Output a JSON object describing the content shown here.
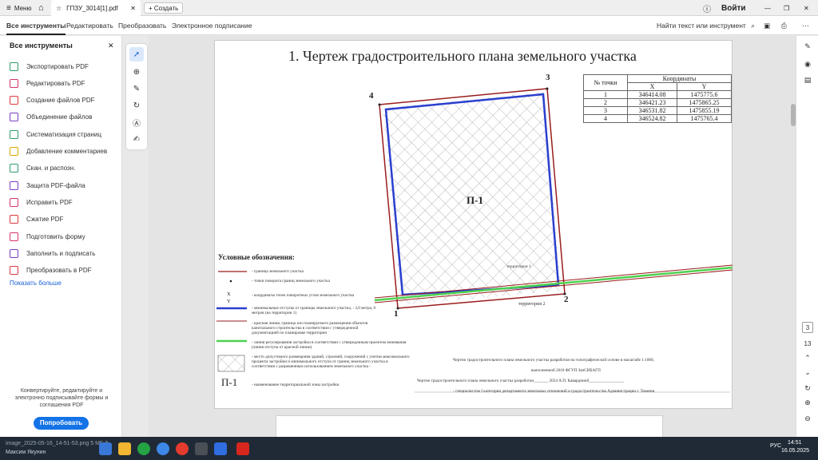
{
  "tabs": {
    "menu": "Меню",
    "doc_tab": "ГПЗУ_3014[1].pdf",
    "create": "+ Создать",
    "signin": "Войти"
  },
  "tools_bar": {
    "items": [
      "Все инструменты",
      "Редактировать",
      "Преобразовать",
      "Электронное подписание"
    ],
    "search": "Найти текст или инструмент"
  },
  "sidebar": {
    "title": "Все инструменты",
    "items": [
      {
        "label": "Экспортировать PDF",
        "color": "#2e9b6a"
      },
      {
        "label": "Редактировать PDF",
        "color": "#d6336c"
      },
      {
        "label": "Создание файлов PDF",
        "color": "#d9393e"
      },
      {
        "label": "Объединение файлов",
        "color": "#7b3fc4"
      },
      {
        "label": "Систематизация страниц",
        "color": "#2e9b6a"
      },
      {
        "label": "Добавление комментариев",
        "color": "#e0a800"
      },
      {
        "label": "Скан. и распозн.",
        "color": "#2e9b6a"
      },
      {
        "label": "Защита PDF-файла",
        "color": "#7b3fc4"
      },
      {
        "label": "Исправить PDF",
        "color": "#d6336c"
      },
      {
        "label": "Сжатие PDF",
        "color": "#d9393e"
      },
      {
        "label": "Подготовить форму",
        "color": "#d6336c"
      },
      {
        "label": "Заполнить и подписать",
        "color": "#7b3fc4"
      },
      {
        "label": "Преобразовать в PDF",
        "color": "#d9393e"
      }
    ],
    "more": "Показать больше",
    "promo": "Конвертируйте, редактируйте и электронно подписывайте формы и соглашения PDF",
    "try": "Попробовать"
  },
  "doc": {
    "title": "1. Чертеж градостроительного плана земельного участка",
    "table": {
      "h1": "№ точки",
      "h2": "Координаты",
      "hx": "X",
      "hy": "Y",
      "rows": [
        [
          "1",
          "346414.08",
          "1475775.6"
        ],
        [
          "2",
          "346421.23",
          "1475865.25"
        ],
        [
          "3",
          "346531.82",
          "1475855.19"
        ],
        [
          "4",
          "346524.82",
          "1475765.4"
        ]
      ]
    },
    "points": [
      "1",
      "2",
      "3",
      "4"
    ],
    "plot_label": "П-1",
    "terr1": "территория 1",
    "terr2": "территория 2",
    "legend_title": "Условные обозначения:",
    "legend": [
      "- граница земельного участка",
      "- точки поворота границ земельного участка",
      "- координаты точек поворотных углов земельного участка",
      "- минимальные отступы от границы земельного участка, - 3,0 метра, 0 метров (на территории 1)",
      "- красная линия, граница зон планируемого размещения объектов капитального строительства в соответствии с утвержденной документацией по планировке территории",
      "- линия регулирования застройки в соответствии с утвержденным проектом межевания (линия отступа от красной линии)",
      "- место допустимого размещения зданий, строений, сооружений с учетом максимального процента застройки и минимального отступа от границ земельного участка в соответствии с разрешенным использованием земельного участка -",
      "- наименование территориальной зоны застройки"
    ],
    "xy_label": "X Y",
    "p1_legend": "П-1",
    "note1": "Чертеж градостроительного плана земельного участка разработан на топографической основе в масштабе 1:1000,",
    "note2": "выполненной 2018 ФГУП ЗапСИБАГП",
    "note3": "Чертеж градостроительного плана земельного участка разработан_______ 2024 А.П. Кавардиной_________________",
    "note4": "- специалистом I категории департамента земельных отношений и градостроительства Администрации г. Тюмени"
  },
  "page_nums": {
    "current": "3",
    "total": "13"
  },
  "taskbar": {
    "file": "image_2025-05-16_14-51-53.png 5 МБ 9",
    "user": "Максим Якунин",
    "lang": "РУС",
    "time": "14:51",
    "date": "16.05.2025"
  }
}
